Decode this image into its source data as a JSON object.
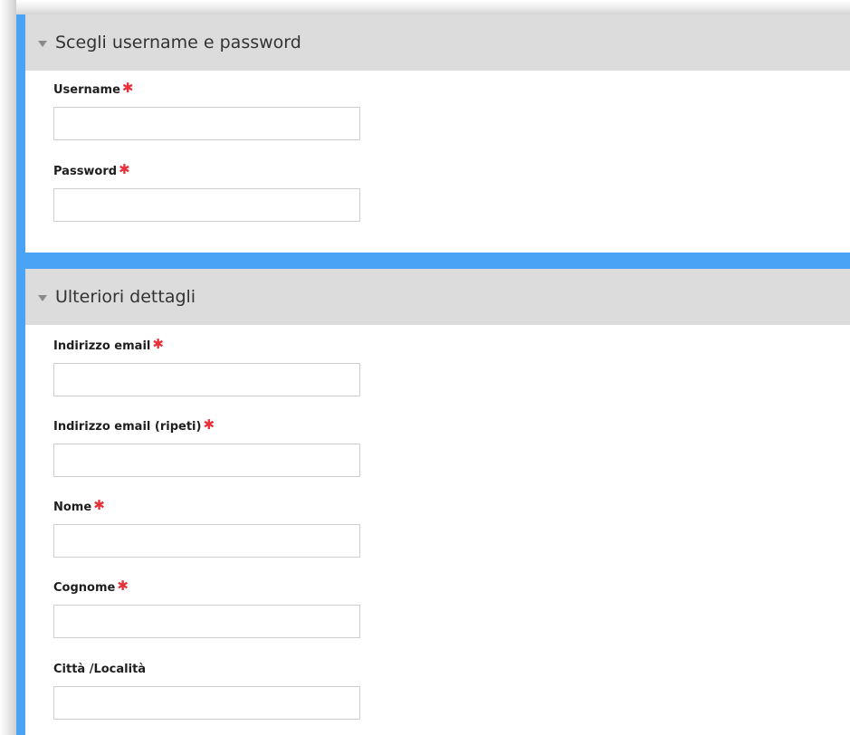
{
  "sections": [
    {
      "title": "Scegli username e password",
      "fields": [
        {
          "label": "Username",
          "required": "✱",
          "value": ""
        },
        {
          "label": "Password",
          "required": "✱",
          "value": ""
        }
      ]
    },
    {
      "title": "Ulteriori dettagli",
      "fields": [
        {
          "label": "Indirizzo email",
          "required": "✱",
          "value": ""
        },
        {
          "label": "Indirizzo email (ripeti)",
          "required": "✱",
          "value": ""
        },
        {
          "label": "Nome",
          "required": "✱",
          "value": ""
        },
        {
          "label": "Cognome",
          "required": "✱",
          "value": ""
        },
        {
          "label": "Città /Località",
          "value": ""
        }
      ]
    }
  ],
  "colors": {
    "accent": "#4ba3f5",
    "header_bg": "#dcdcdc",
    "required": "#e8303a"
  }
}
